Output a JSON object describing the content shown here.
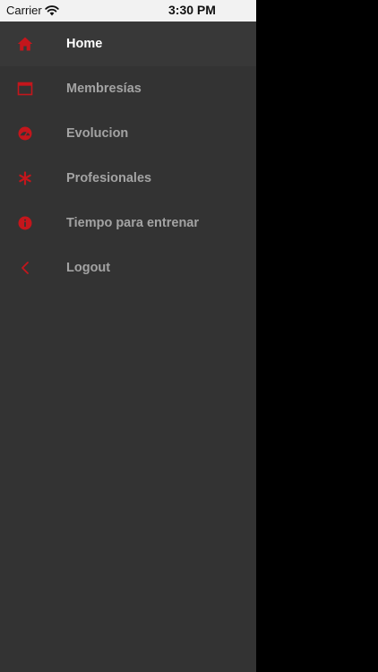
{
  "status_bar": {
    "carrier": "Carrier",
    "time": "3:30 PM",
    "wifi_icon": "wifi-icon"
  },
  "colors": {
    "accent": "#c4161c",
    "drawer_background": "#333333",
    "active_text": "#ffffff",
    "inactive_text": "#a3a3a3",
    "backdrop": "#000000"
  },
  "menu": {
    "items": [
      {
        "label": "Home",
        "icon": "home-icon",
        "active": true
      },
      {
        "label": "Membresías",
        "icon": "calendar-icon",
        "active": false
      },
      {
        "label": "Evolucion",
        "icon": "gauge-icon",
        "active": false
      },
      {
        "label": "Profesionales",
        "icon": "asterisk-icon",
        "active": false
      },
      {
        "label": "Tiempo para entrenar",
        "icon": "info-circle-icon",
        "active": false
      },
      {
        "label": "Logout",
        "icon": "chevron-left-icon",
        "active": false
      }
    ]
  }
}
